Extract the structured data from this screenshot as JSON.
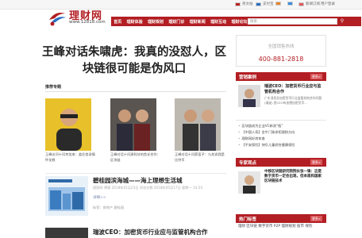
{
  "topbar": {
    "lang": "英文站",
    "pay": "支付宝",
    "sns1": "",
    "login": "登录",
    "news": "新闻订阅",
    "user": "用户登录"
  },
  "logo": {
    "name": "理财网",
    "url": "www.12818.com"
  },
  "nav": {
    "items": [
      "首页",
      "理财体验",
      "理财规划",
      "理财门诊",
      "理财新闻",
      "理财互动",
      "理财论坛"
    ],
    "search_placeholder": "搜索"
  },
  "headline": "王峰对话朱啸虎：我真的没怼人，区块链很可能是伪风口",
  "featured": {
    "title": "推荐专题",
    "cards": [
      {
        "caption": "王峰访问十问李笑来：盖伦首说情怀化数"
      },
      {
        "caption": "王峰对话十问源科技的首长合作：区块链"
      },
      {
        "caption": "王峰对话十问薛蛮子：与其说我是比特币"
      }
    ]
  },
  "articles": [
    {
      "title": "碧桂园滨海城——海上理想生活城",
      "meta": "理财网   博客   2018年01月23日   浏览次数 2018年05月17日 星期一 14:24",
      "more": "详细>>",
      "tags": "标签：房地产   碧桂园"
    },
    {
      "title": "瑞波CEO：加密货币行业应与监管机构合作",
      "meta": "",
      "more": "",
      "tags": ""
    }
  ],
  "right": {
    "hotline_label": "全国销售热线",
    "hotline_number": "400-881-2818",
    "case_bar": "营销案例",
    "more": "更多>",
    "case_title": "瑞波CEO：加密货币行业应与监管机构合作",
    "case_desc": "广东消息及加密货币行业监管机构合作问题 (瑞波) 首CEO布加德加密货币…",
    "list": [
      "区块链成为企业VC新流“瓶”",
      "【中国人寿】金牛门致命招理财方向",
      "理财网好房车查",
      "【平安保险】快乐儿童综合健康保险"
    ],
    "expert_bar": "专家观点",
    "expert_title": "中移区块链研究院院长张一锋：这是数字货币一定会出现，但本质和国家区块链技术",
    "expert_desc": "中国区块链研究联盟高级顾问…",
    "tags_bar": "热门标签",
    "tags": "理财  区块链  数字货币  P2P  理财规划  股市  保险"
  }
}
